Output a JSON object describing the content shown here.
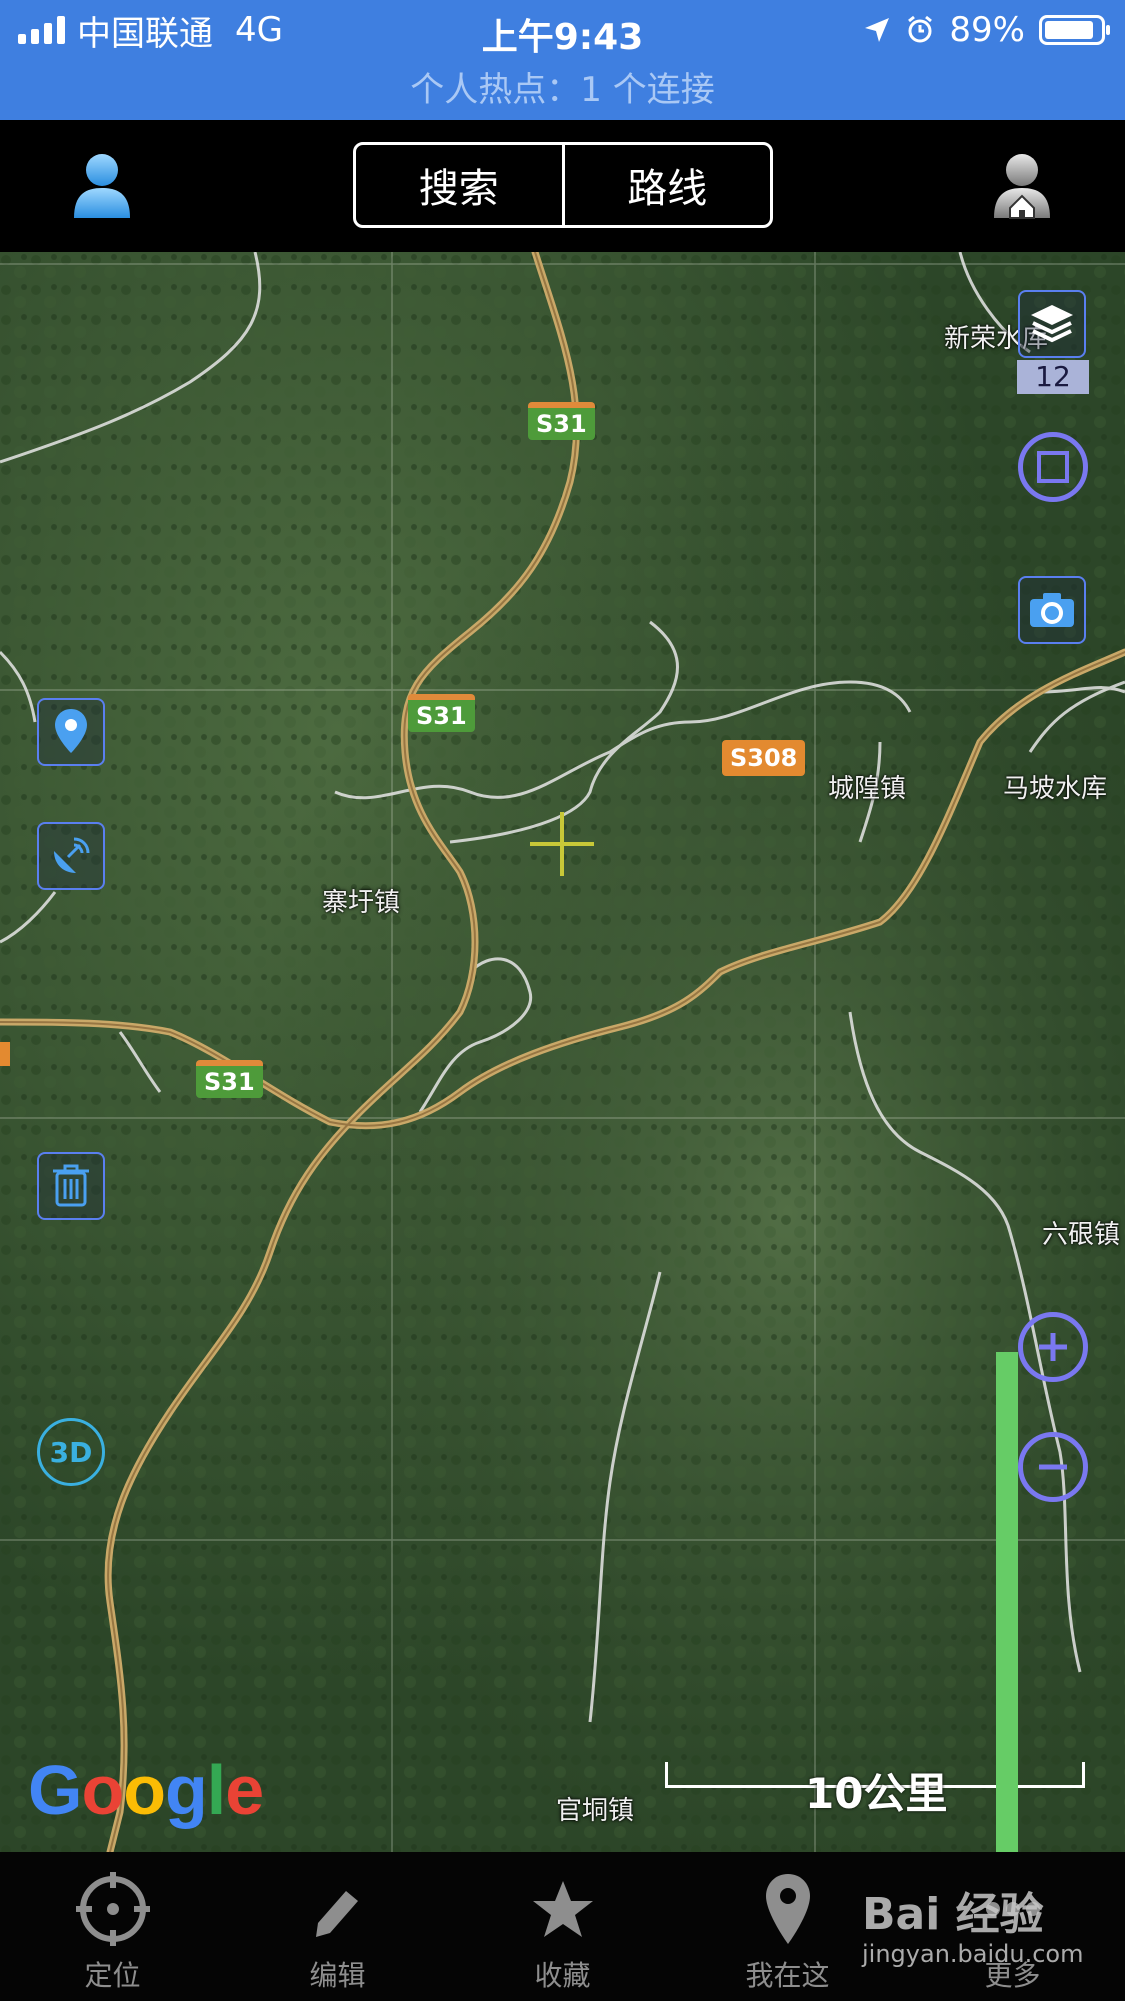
{
  "status_bar": {
    "carrier": "中国联通",
    "network": "4G",
    "time": "上午9:43",
    "battery": "89%",
    "hotspot": "个人热点：1 个连接"
  },
  "nav": {
    "tabs": [
      {
        "label": "搜索"
      },
      {
        "label": "路线"
      }
    ]
  },
  "map": {
    "zoom_level": "12",
    "road_labels": [
      "S31",
      "S31",
      "S31",
      "S308"
    ],
    "places": [
      "新荣水库",
      "城隍镇",
      "马坡水库",
      "寨圩镇",
      "六硍镇",
      "官垌镇"
    ],
    "scale": "10公里",
    "attribution": "Google",
    "layers_icon": "layers-icon",
    "zoom_in_icon": "plus-icon",
    "zoom_out_icon": "minus-icon",
    "three_d_label": "3D"
  },
  "tabbar": {
    "items": [
      {
        "label": "定位",
        "icon": "locate-icon"
      },
      {
        "label": "编辑",
        "icon": "pencil-icon"
      },
      {
        "label": "收藏",
        "icon": "star-icon"
      },
      {
        "label": "我在这",
        "icon": "pin-icon"
      },
      {
        "label": "更多",
        "icon": "more-icon"
      }
    ]
  },
  "watermark": {
    "brand": "Bai 经验",
    "url": "jingyan.baidu.com"
  },
  "colors": {
    "status_bar": "#3f7fe0",
    "accent_blue": "#5a7ff0",
    "arrow_green": "#66cc66",
    "road_green": "#4e9b3a",
    "road_orange": "#e38a30"
  }
}
